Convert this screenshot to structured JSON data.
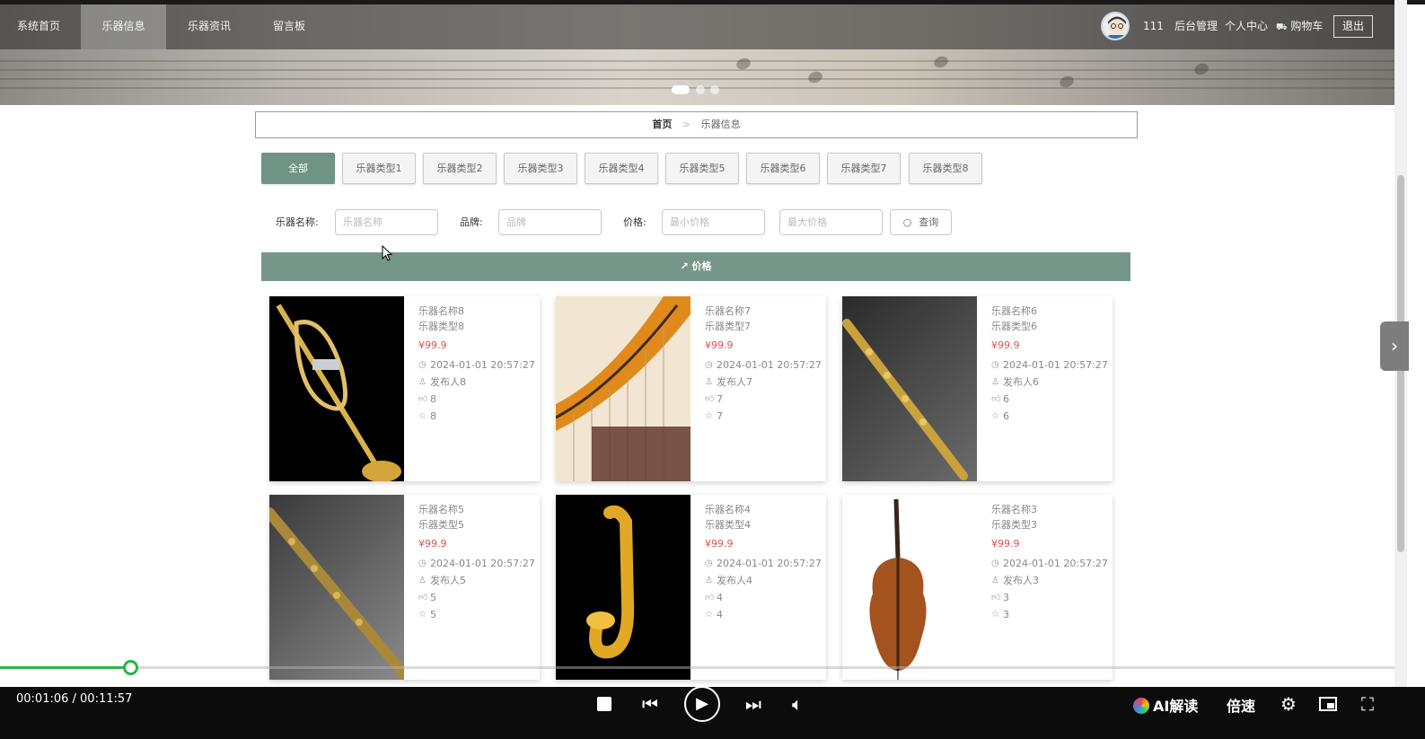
{
  "nav": {
    "items": [
      {
        "label": "系统首页",
        "active": false
      },
      {
        "label": "乐器信息",
        "active": true
      },
      {
        "label": "乐器资讯",
        "active": false
      },
      {
        "label": "留言板",
        "active": false
      }
    ],
    "username": "111",
    "admin": "后台管理",
    "profile": "个人中心",
    "cart": "购物车",
    "logout": "退出"
  },
  "breadcrumb": {
    "home": "首页",
    "separator": ">",
    "current": "乐器信息"
  },
  "categories": [
    {
      "label": "全部",
      "active": true
    },
    {
      "label": "乐器类型1",
      "active": false
    },
    {
      "label": "乐器类型2",
      "active": false
    },
    {
      "label": "乐器类型3",
      "active": false
    },
    {
      "label": "乐器类型4",
      "active": false
    },
    {
      "label": "乐器类型5",
      "active": false
    },
    {
      "label": "乐器类型6",
      "active": false
    },
    {
      "label": "乐器类型7",
      "active": false
    },
    {
      "label": "乐器类型8",
      "active": false
    }
  ],
  "search": {
    "name_label": "乐器名称:",
    "name_placeholder": "乐器名称",
    "brand_label": "品牌:",
    "brand_placeholder": "品牌",
    "price_label": "价格:",
    "min_placeholder": "最小价格",
    "max_placeholder": "最大价格",
    "button": "查询"
  },
  "sort": {
    "label": "价格"
  },
  "products": [
    {
      "name": "乐器名称8",
      "type": "乐器类型8",
      "price": "¥99.9",
      "time": "2024-01-01 20:57:27",
      "publisher": "发布人8",
      "likes": "8",
      "favs": "8",
      "image": "trumpet"
    },
    {
      "name": "乐器名称7",
      "type": "乐器类型7",
      "price": "¥99.9",
      "time": "2024-01-01 20:57:27",
      "publisher": "发布人7",
      "likes": "7",
      "favs": "7",
      "image": "harp"
    },
    {
      "name": "乐器名称6",
      "type": "乐器类型6",
      "price": "¥99.9",
      "time": "2024-01-01 20:57:27",
      "publisher": "发布人6",
      "likes": "6",
      "favs": "6",
      "image": "soprano-sax"
    },
    {
      "name": "乐器名称5",
      "type": "乐器类型5",
      "price": "¥99.9",
      "time": "2024-01-01 20:57:27",
      "publisher": "发布人5",
      "likes": "5",
      "favs": "5",
      "image": "soprano-sax-2"
    },
    {
      "name": "乐器名称4",
      "type": "乐器类型4",
      "price": "¥99.9",
      "time": "2024-01-01 20:57:27",
      "publisher": "发布人4",
      "likes": "4",
      "favs": "4",
      "image": "alto-sax"
    },
    {
      "name": "乐器名称3",
      "type": "乐器类型3",
      "price": "¥99.9",
      "time": "2024-01-01 20:57:27",
      "publisher": "发布人3",
      "likes": "3",
      "favs": "3",
      "image": "cello"
    }
  ],
  "player": {
    "time": "00:01:06 / 00:11:57",
    "progress": 0.092,
    "ai_label": "AI解读",
    "speed_label": "倍速"
  },
  "colors": {
    "accent": "#769689",
    "price": "#d9534f",
    "progress": "#2bb34c"
  }
}
